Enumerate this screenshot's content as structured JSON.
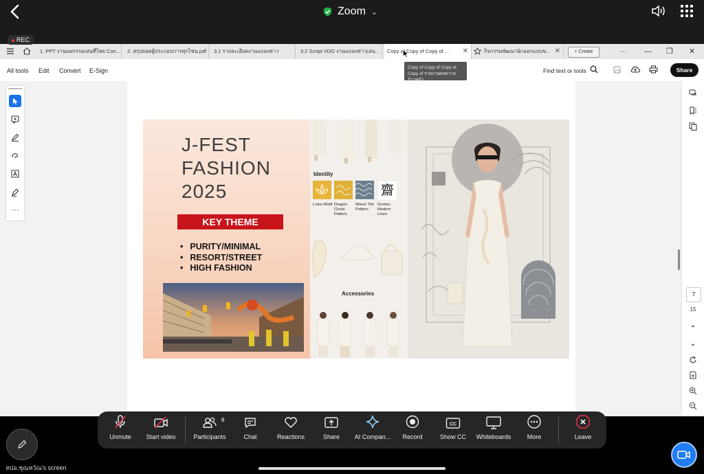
{
  "zoom": {
    "title": "Zoom",
    "rec_label": "REC",
    "shared_screen_label": "สปอ.ชุณหวัณ's screen"
  },
  "browser": {
    "tabs": [
      {
        "label": "1. PPT งานแผกรรมเสนที่ไทย Con..."
      },
      {
        "label": "2. สรุปยอดผู้ประกอบการทุกไชน.pdf"
      },
      {
        "label": "3.1 รายละเอียดงานแถลงข่าว"
      },
      {
        "label": "3.2 Script VDO งานแถลงข่าวเสน..."
      },
      {
        "label": "Copy of Copy of Copy of ..."
      },
      {
        "label": "กิจกรรมพัฒนานักออกแบบข..."
      }
    ],
    "create_label": "Create",
    "tooltip_lines": [
      "Copy of Copy of Copy of",
      "Copy of รายงานผลความก้าวหน้า"
    ]
  },
  "acrobat": {
    "menu": [
      "All tools",
      "Edit",
      "Convert",
      "E-Sign"
    ],
    "find_label": "Find text or tools",
    "share_label": "Share",
    "current_page": "7",
    "total_pages": "15"
  },
  "slide": {
    "title_lines": [
      "J-FEST",
      "FASHION",
      "2025"
    ],
    "key_theme": "KEY THEME",
    "bullets": [
      "PURITY/MINIMAL",
      "RESORT/STREET",
      "HIGH FASHION"
    ],
    "identity_label": "Identity",
    "identity_items": [
      {
        "name": "Lotus Motif",
        "color": "#e9b43a"
      },
      {
        "name": "Dragon Cloud Pattern",
        "color": "#e0b23a"
      },
      {
        "name": "Wave/ Tile Pattern",
        "color": "#6b7f8c"
      },
      {
        "name": "Grome-Modern Lines",
        "color": "#ffffff"
      }
    ],
    "accessories_label": "Accessories"
  },
  "meeting_bar": {
    "buttons": [
      {
        "label": "Unmute",
        "icon": "mic-muted-icon"
      },
      {
        "label": "Start video",
        "icon": "video-off-icon"
      },
      {
        "label": "Participants",
        "icon": "participants-icon"
      },
      {
        "label": "Chat",
        "icon": "chat-icon"
      },
      {
        "label": "Reactions",
        "icon": "heart-icon"
      },
      {
        "label": "Share",
        "icon": "share-icon"
      },
      {
        "label": "AI Compan...",
        "icon": "sparkle-icon"
      },
      {
        "label": "Record",
        "icon": "record-icon"
      },
      {
        "label": "Show CC",
        "icon": "cc-icon"
      },
      {
        "label": "Whiteboards",
        "icon": "whiteboard-icon"
      },
      {
        "label": "More",
        "icon": "more-icon"
      },
      {
        "label": "Leave",
        "icon": "leave-icon"
      }
    ],
    "participants_count": "8",
    "colors": {
      "leave": "#e0334a",
      "accent": "#1f7cf2"
    }
  }
}
